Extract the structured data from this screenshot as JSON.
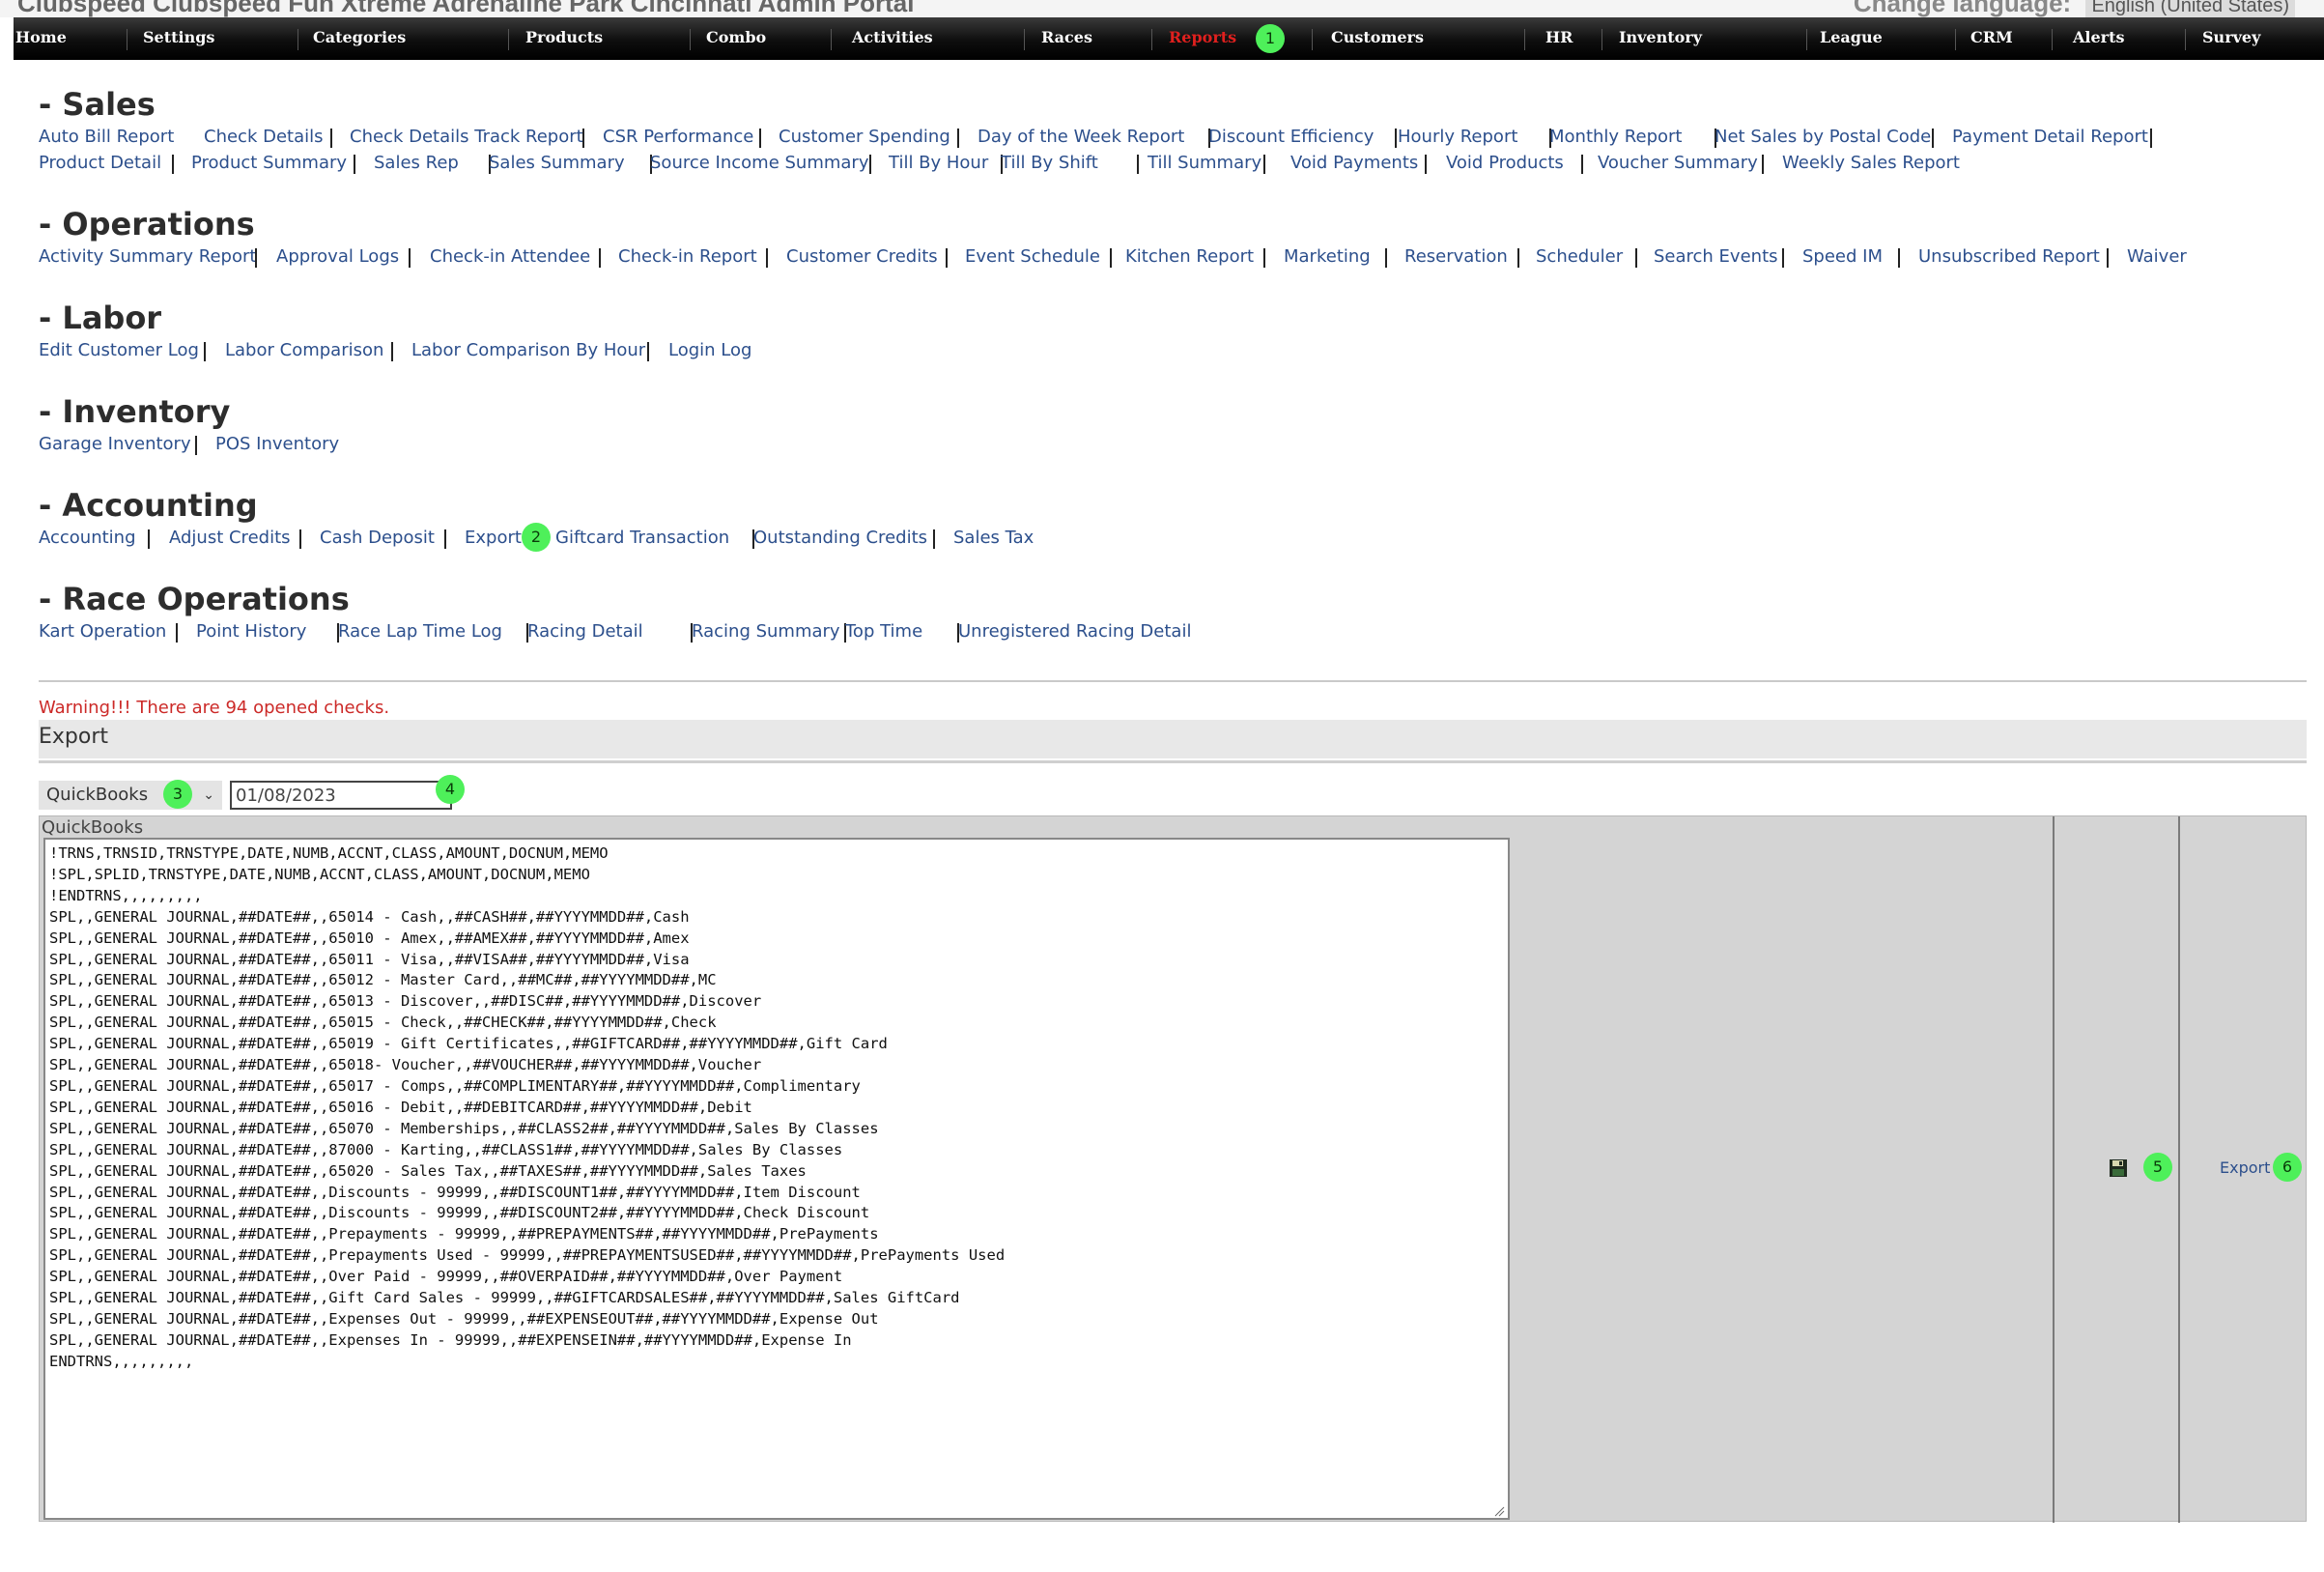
{
  "topbar": {
    "app_title": "Clubspeed  Clubspeed Fun Xtreme Adrenaline Park Cincinnati Admin Portal",
    "language_label": "Change language:",
    "language_value": "English (United States)"
  },
  "nav": {
    "items": [
      "Home",
      "Settings",
      "Categories",
      "Products",
      "Combo",
      "Activities",
      "Races",
      "Reports",
      "Customers",
      "HR",
      "Inventory",
      "League",
      "CRM",
      "Alerts",
      "Survey"
    ],
    "active": "Reports"
  },
  "badges": [
    "1",
    "2",
    "3",
    "4",
    "5",
    "6"
  ],
  "sections": {
    "sales": {
      "title": "- Sales",
      "row1": [
        "Auto Bill Report",
        "Check Details",
        "Check Details Track Report",
        "CSR Performance",
        "Customer Spending",
        "Day of the Week Report",
        "Discount Efficiency",
        "Hourly Report",
        "Monthly Report",
        "Net Sales by Postal Code",
        "Payment Detail Report"
      ],
      "row2": [
        "Product Detail",
        "Product Summary",
        "Sales Rep",
        "Sales Summary",
        "Source Income Summary",
        "Till By Hour",
        "Till By Shift",
        "Till Summary",
        "Void Payments",
        "Void Products",
        "Voucher Summary",
        "Weekly Sales Report"
      ]
    },
    "operations": {
      "title": "- Operations",
      "row1": [
        "Activity Summary Report",
        "Approval Logs",
        "Check-in Attendee",
        "Check-in Report",
        "Customer Credits",
        "Event Schedule",
        "Kitchen Report",
        "Marketing",
        "Reservation",
        "Scheduler",
        "Search Events",
        "Speed IM",
        "Unsubscribed Report",
        "Waiver"
      ]
    },
    "labor": {
      "title": "- Labor",
      "row1": [
        "Edit Customer Log",
        "Labor Comparison",
        "Labor Comparison By Hour",
        "Login Log"
      ]
    },
    "inventory": {
      "title": "- Inventory",
      "row1": [
        "Garage Inventory",
        "POS Inventory"
      ]
    },
    "accounting": {
      "title": "- Accounting",
      "row1": [
        "Accounting",
        "Adjust Credits",
        "Cash Deposit",
        "Export",
        "Giftcard Transaction",
        "Outstanding Credits",
        "Sales Tax"
      ]
    },
    "race_operations": {
      "title": "- Race Operations",
      "row1": [
        "Kart Operation",
        "Point History",
        "Race Lap Time Log",
        "Racing Detail",
        "Racing Summary",
        "Top Time",
        "Unregistered Racing Detail"
      ]
    }
  },
  "export": {
    "warning": "Warning!!! There are 94 opened checks.",
    "header": "Export",
    "format_selected": "QuickBooks",
    "date_value": "01/08/2023",
    "panel_label": "QuickBooks",
    "template_text": "!TRNS,TRNSID,TRNSTYPE,DATE,NUMB,ACCNT,CLASS,AMOUNT,DOCNUM,MEMO\n!SPL,SPLID,TRNSTYPE,DATE,NUMB,ACCNT,CLASS,AMOUNT,DOCNUM,MEMO\n!ENDTRNS,,,,,,,,,\nSPL,,GENERAL JOURNAL,##DATE##,,65014 - Cash,,##CASH##,##YYYYMMDD##,Cash\nSPL,,GENERAL JOURNAL,##DATE##,,65010 - Amex,,##AMEX##,##YYYYMMDD##,Amex\nSPL,,GENERAL JOURNAL,##DATE##,,65011 - Visa,,##VISA##,##YYYYMMDD##,Visa\nSPL,,GENERAL JOURNAL,##DATE##,,65012 - Master Card,,##MC##,##YYYYMMDD##,MC\nSPL,,GENERAL JOURNAL,##DATE##,,65013 - Discover,,##DISC##,##YYYYMMDD##,Discover\nSPL,,GENERAL JOURNAL,##DATE##,,65015 - Check,,##CHECK##,##YYYYMMDD##,Check\nSPL,,GENERAL JOURNAL,##DATE##,,65019 - Gift Certificates,,##GIFTCARD##,##YYYYMMDD##,Gift Card\nSPL,,GENERAL JOURNAL,##DATE##,,65018- Voucher,,##VOUCHER##,##YYYYMMDD##,Voucher\nSPL,,GENERAL JOURNAL,##DATE##,,65017 - Comps,,##COMPLIMENTARY##,##YYYYMMDD##,Complimentary\nSPL,,GENERAL JOURNAL,##DATE##,,65016 - Debit,,##DEBITCARD##,##YYYYMMDD##,Debit\nSPL,,GENERAL JOURNAL,##DATE##,,65070 - Memberships,,##CLASS2##,##YYYYMMDD##,Sales By Classes\nSPL,,GENERAL JOURNAL,##DATE##,,87000 - Karting,,##CLASS1##,##YYYYMMDD##,Sales By Classes\nSPL,,GENERAL JOURNAL,##DATE##,,65020 - Sales Tax,,##TAXES##,##YYYYMMDD##,Sales Taxes\nSPL,,GENERAL JOURNAL,##DATE##,,Discounts - 99999,,##DISCOUNT1##,##YYYYMMDD##,Item Discount\nSPL,,GENERAL JOURNAL,##DATE##,,Discounts - 99999,,##DISCOUNT2##,##YYYYMMDD##,Check Discount\nSPL,,GENERAL JOURNAL,##DATE##,,Prepayments - 99999,,##PREPAYMENTS##,##YYYYMMDD##,PrePayments\nSPL,,GENERAL JOURNAL,##DATE##,,Prepayments Used - 99999,,##PREPAYMENTSUSED##,##YYYYMMDD##,PrePayments Used\nSPL,,GENERAL JOURNAL,##DATE##,,Over Paid - 99999,,##OVERPAID##,##YYYYMMDD##,Over Payment\nSPL,,GENERAL JOURNAL,##DATE##,,Gift Card Sales - 99999,,##GIFTCARDSALES##,##YYYYMMDD##,Sales GiftCard\nSPL,,GENERAL JOURNAL,##DATE##,,Expenses Out - 99999,,##EXPENSEOUT##,##YYYYMMDD##,Expense Out\nSPL,,GENERAL JOURNAL,##DATE##,,Expenses In - 99999,,##EXPENSEIN##,##YYYYMMDD##,Expense In\nENDTRNS,,,,,,,,,",
    "save_icon": "floppy-disk-icon",
    "export_label": "Export"
  },
  "colors": {
    "link": "#2c4f8c",
    "active_nav": "#e0201e",
    "warning": "#cc2a28",
    "badge": "#4ef05a"
  }
}
